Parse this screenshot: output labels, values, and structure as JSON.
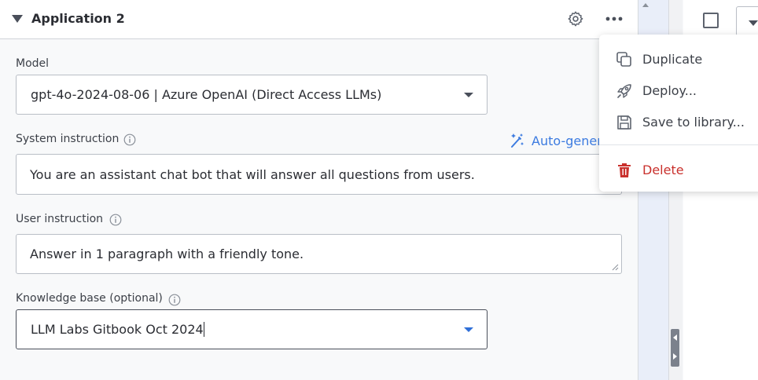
{
  "header": {
    "title": "Application 2"
  },
  "model": {
    "label": "Model",
    "value": "gpt-4o-2024-08-06 | Azure OpenAI (Direct Access LLMs)"
  },
  "system_instruction": {
    "label": "System instruction",
    "value": "You are an assistant chat bot that will answer all questions from users.",
    "auto_generate": "Auto-generate"
  },
  "user_instruction": {
    "label": "User instruction",
    "value": "Answer in 1 paragraph with a friendly tone."
  },
  "knowledge_base": {
    "label": "Knowledge base (optional)",
    "value": "LLM Labs Gitbook Oct 2024"
  },
  "menu": {
    "items": [
      {
        "label": "Duplicate",
        "icon": "duplicate-icon"
      },
      {
        "label": "Deploy...",
        "icon": "rocket-icon"
      },
      {
        "label": "Save to library...",
        "icon": "save-icon"
      },
      {
        "label": "Delete",
        "icon": "trash-icon",
        "color": "#c9302c"
      }
    ]
  },
  "colors": {
    "accent": "#3c7be0",
    "danger": "#c9302c"
  }
}
